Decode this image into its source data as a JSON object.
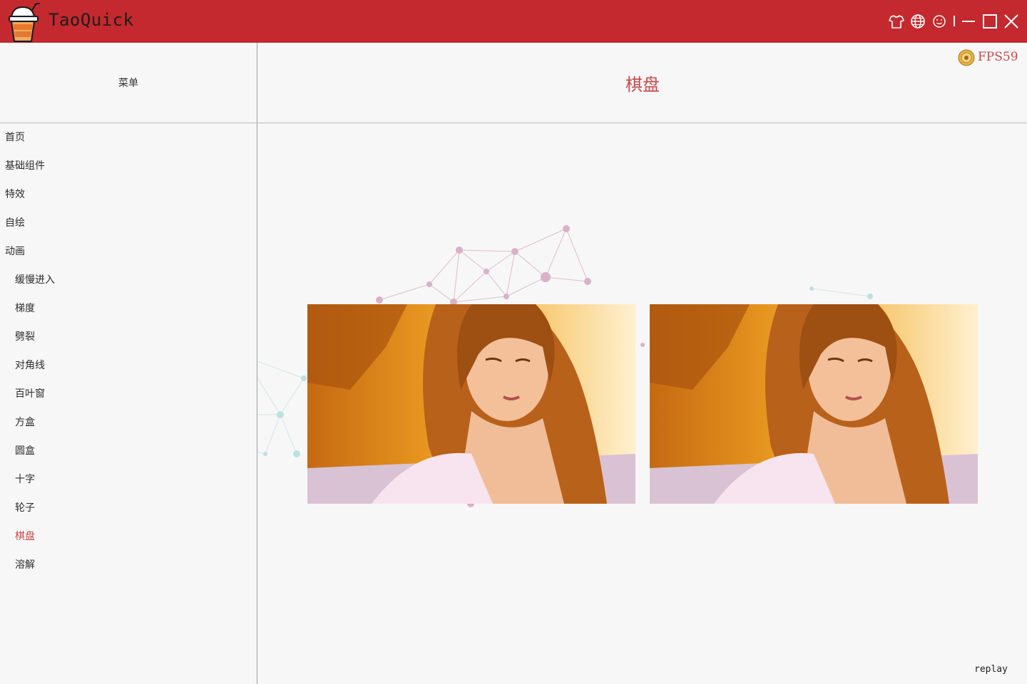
{
  "app": {
    "title": "TaoQuick"
  },
  "titlebar": {
    "icons": [
      "shirt-icon",
      "globe-icon",
      "smiley-icon",
      "minimize-icon",
      "maximize-icon",
      "close-icon"
    ],
    "color": "#c3292e"
  },
  "sidebar": {
    "title": "菜单",
    "items": [
      {
        "label": "首页"
      },
      {
        "label": "基础组件"
      },
      {
        "label": "特效"
      },
      {
        "label": "自绘"
      },
      {
        "label": "动画"
      },
      {
        "label": "缓慢进入"
      },
      {
        "label": "梯度"
      },
      {
        "label": "劈裂"
      },
      {
        "label": "对角线"
      },
      {
        "label": "百叶窗"
      },
      {
        "label": "方盒"
      },
      {
        "label": "圆盒"
      },
      {
        "label": "十字"
      },
      {
        "label": "轮子"
      },
      {
        "label": "棋盘"
      },
      {
        "label": "溶解"
      }
    ],
    "active_label": "棋盘"
  },
  "main": {
    "title": "棋盘",
    "fps": "FPS59",
    "replay": "replay",
    "images": [
      "portrait-image",
      "portrait-image"
    ],
    "accent": "#c94848"
  }
}
